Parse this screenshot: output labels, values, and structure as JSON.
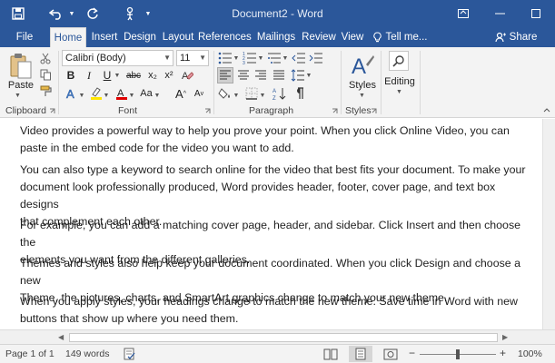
{
  "window": {
    "title": "Document2 - Word"
  },
  "tabs": [
    {
      "label": "File"
    },
    {
      "label": "Home"
    },
    {
      "label": "Insert"
    },
    {
      "label": "Design"
    },
    {
      "label": "Layout"
    },
    {
      "label": "References"
    },
    {
      "label": "Mailings"
    },
    {
      "label": "Review"
    },
    {
      "label": "View"
    }
  ],
  "tellme": {
    "label": "Tell me..."
  },
  "share": {
    "label": "Share"
  },
  "ribbon": {
    "clipboard": {
      "paste_label": "Paste",
      "group_label": "Clipboard"
    },
    "font": {
      "font_name": "Calibri (Body)",
      "font_size": "11",
      "group_label": "Font",
      "bold": "B",
      "italic": "I",
      "underline": "U",
      "strike": "abc",
      "sub": "x₂",
      "sup": "x²",
      "change_case": "Aa",
      "grow": "A",
      "shrink": "A"
    },
    "paragraph": {
      "group_label": "Paragraph"
    },
    "styles": {
      "label": "Styles",
      "group_label": "Styles"
    },
    "editing": {
      "label": "Editing"
    }
  },
  "document": {
    "paragraphs": [
      [
        "Video provides a powerful way to help you prove your point. When you click Online Video, you can",
        "paste in the embed code for the video you want to add."
      ],
      [
        "You can also type a keyword to search online for the video that best fits your document. To make your",
        "document look professionally produced, Word provides header, footer, cover page, and text box designs",
        "that complement each other."
      ],
      [
        "For example, you can add a matching cover page, header, and sidebar. Click Insert and then choose the",
        "elements you want from the different galleries."
      ],
      [
        "Themes and styles also help keep your document coordinated. When you click Design and choose a new",
        "Theme, the pictures, charts, and SmartArt graphics change to match your new theme."
      ],
      [
        "When you apply styles, your headings change to match the new theme. Save time in Word with new",
        "buttons that show up where you need them."
      ]
    ]
  },
  "status": {
    "page": "Page 1 of 1",
    "words": "149 words",
    "zoom": "100%",
    "zoom_level": 1.0
  },
  "colors": {
    "brand": "#2b579a",
    "ribbon_bg": "#f3f3f3"
  }
}
